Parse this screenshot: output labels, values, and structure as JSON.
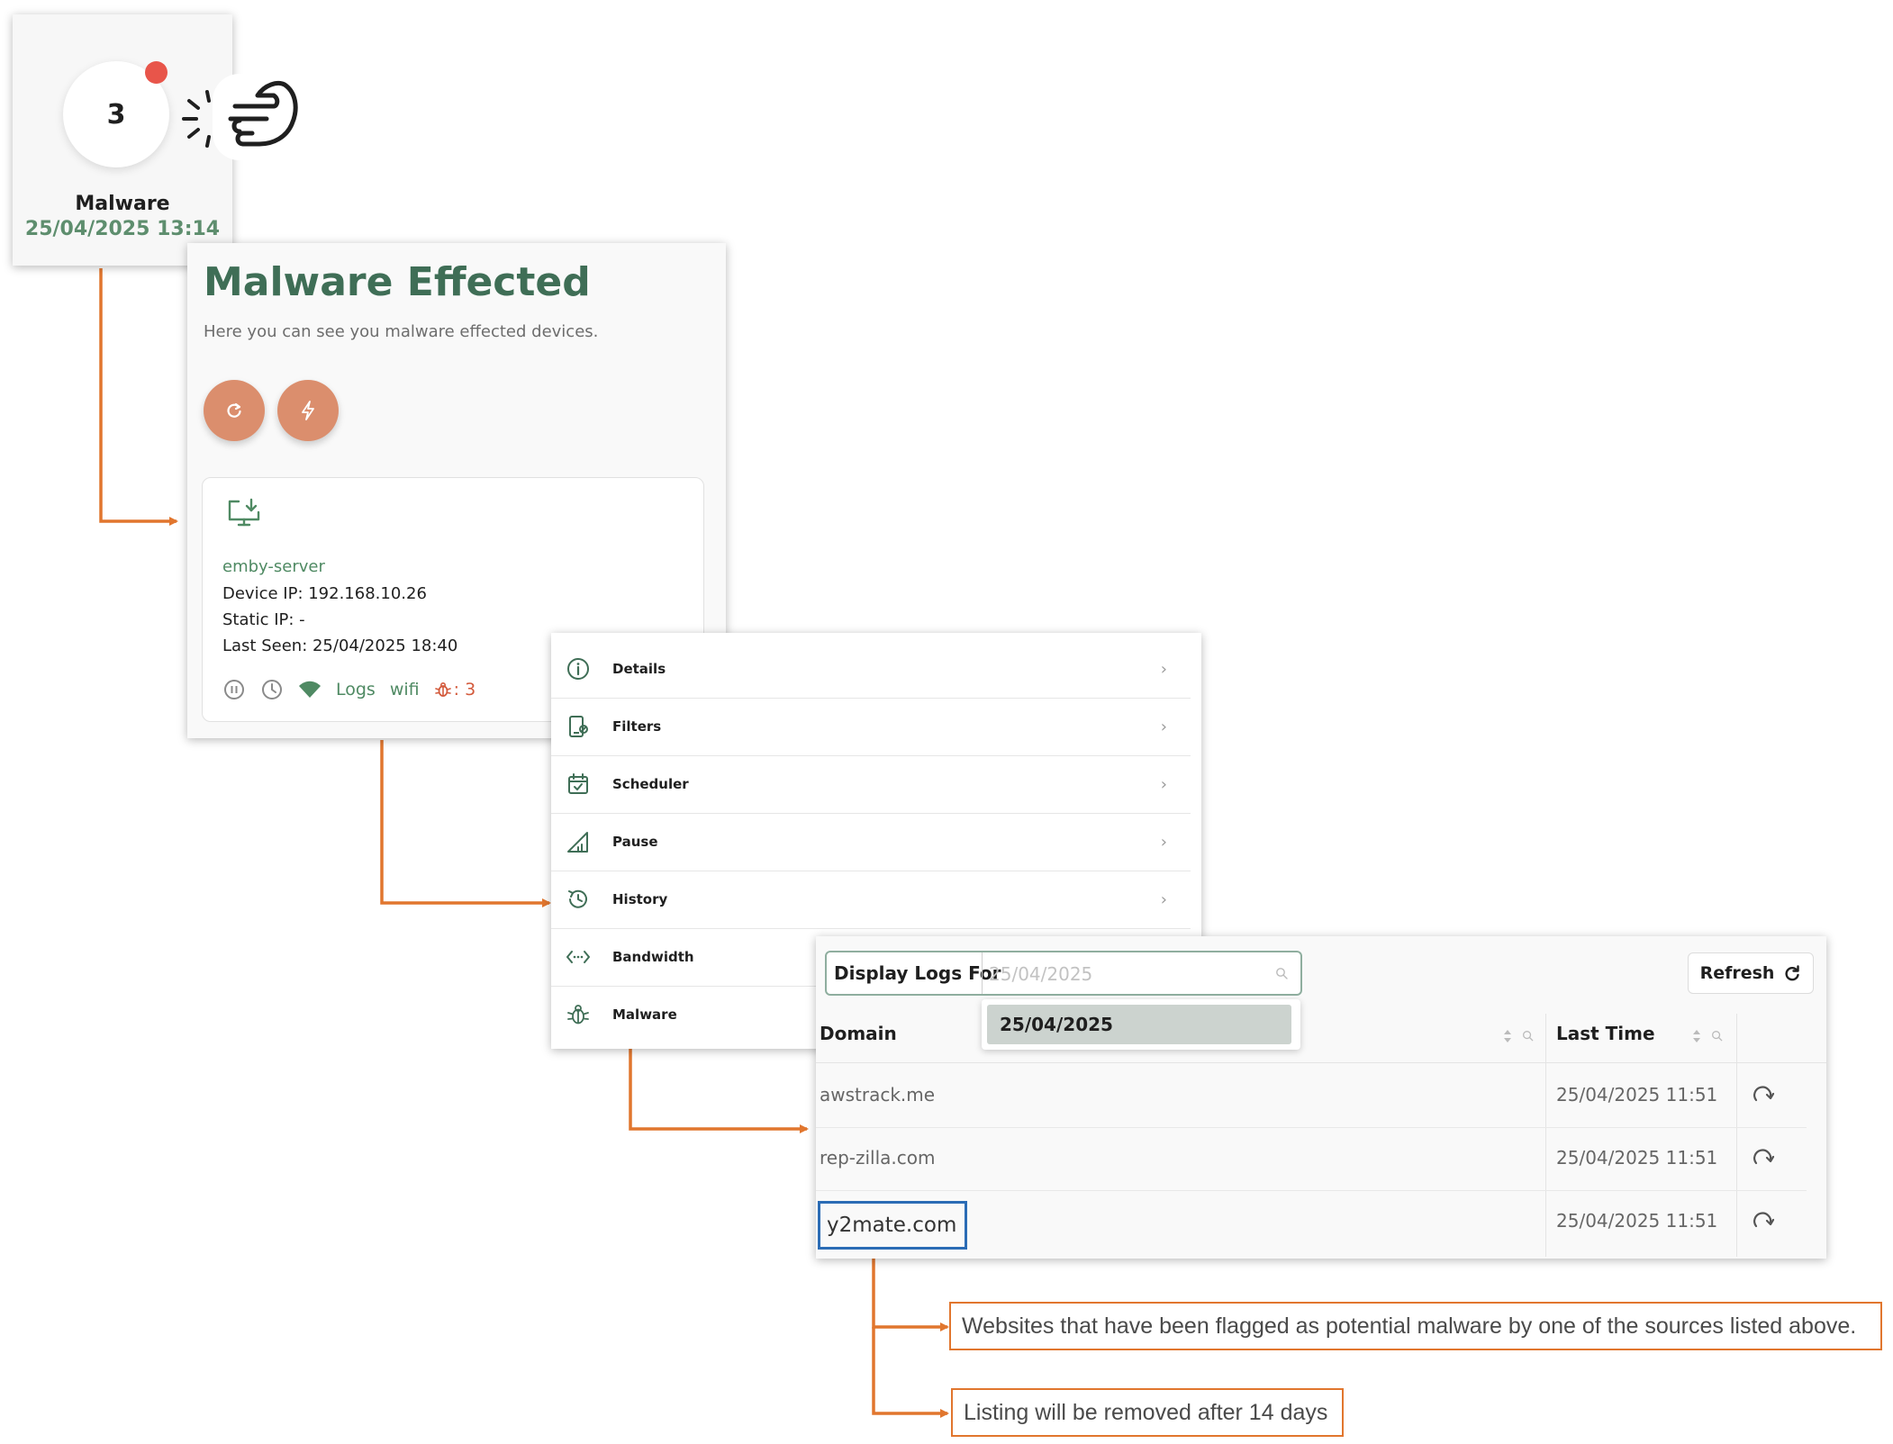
{
  "widget": {
    "count": "3",
    "label": "Malware",
    "time": "25/04/2025 13:14"
  },
  "malware_panel": {
    "title": "Malware Effected",
    "subtitle": "Here you can see you malware effected devices.",
    "device": {
      "name": "emby-server",
      "ip_line": "Device IP: 192.168.10.26",
      "static_line": "Static IP: -",
      "seen_line": "Last Seen: 25/04/2025 18:40",
      "logs_label": "Logs",
      "wifi_label": "wifi",
      "malware_count": ": 3"
    }
  },
  "menu": {
    "items": [
      {
        "label": "Details",
        "icon": "info-icon",
        "chevron": "›"
      },
      {
        "label": "Filters",
        "icon": "filter-icon",
        "chevron": "›"
      },
      {
        "label": "Scheduler",
        "icon": "calendar-icon",
        "chevron": "›"
      },
      {
        "label": "Pause",
        "icon": "signal-icon",
        "chevron": "›"
      },
      {
        "label": "History",
        "icon": "history-icon",
        "chevron": "›"
      },
      {
        "label": "Bandwidth",
        "icon": "bandwidth-icon",
        "chevron": ""
      },
      {
        "label": "Malware",
        "icon": "bug-icon",
        "chevron": ""
      }
    ]
  },
  "logs": {
    "filter_label": "Display Logs For",
    "date_placeholder": "25/04/2025",
    "refresh_label": "Refresh",
    "dropdown_option": "25/04/2025",
    "columns": {
      "domain": "Domain",
      "last_time": "Last Time"
    },
    "rows": [
      {
        "domain": "awstrack.me",
        "last_time": "25/04/2025 11:51"
      },
      {
        "domain": "rep-zilla.com",
        "last_time": "25/04/2025 11:51"
      },
      {
        "domain": "y2mate.com",
        "last_time": "25/04/2025 11:51"
      }
    ]
  },
  "callouts": {
    "flagged": "Websites that have been flagged as potential malware by one of the sources listed above.",
    "removal": "Listing will be removed after 14 days"
  },
  "colors": {
    "accent_green": "#3f6e56",
    "button_orange": "#db8e6d",
    "connector_orange": "#e1762e",
    "notification_red": "#e8554a",
    "highlight_blue": "#2b6cb5"
  }
}
